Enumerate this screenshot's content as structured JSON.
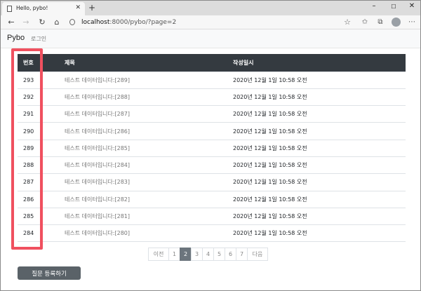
{
  "browser": {
    "tab_title": "Hello, pybo!",
    "url_host": "localhost",
    "url_rest": ":8000/pybo/?page=2",
    "new_tab": "+",
    "minimize": "–",
    "maximize": "☐",
    "close": "✕"
  },
  "navbar": {
    "brand": "Pybo",
    "login": "로그인"
  },
  "table": {
    "headers": {
      "num": "번호",
      "subject": "제목",
      "created": "작성일시"
    },
    "rows": [
      {
        "num": "293",
        "subject": "테스트 데이터입니다:[289]",
        "created": "2020년 12월 1일 10:58 오전"
      },
      {
        "num": "292",
        "subject": "테스트 데이터입니다:[288]",
        "created": "2020년 12월 1일 10:58 오전"
      },
      {
        "num": "291",
        "subject": "테스트 데이터입니다:[287]",
        "created": "2020년 12월 1일 10:58 오전"
      },
      {
        "num": "290",
        "subject": "테스트 데이터입니다:[286]",
        "created": "2020년 12월 1일 10:58 오전"
      },
      {
        "num": "289",
        "subject": "테스트 데이터입니다:[285]",
        "created": "2020년 12월 1일 10:58 오전"
      },
      {
        "num": "288",
        "subject": "테스트 데이터입니다:[284]",
        "created": "2020년 12월 1일 10:58 오전"
      },
      {
        "num": "287",
        "subject": "테스트 데이터입니다:[283]",
        "created": "2020년 12월 1일 10:58 오전"
      },
      {
        "num": "286",
        "subject": "테스트 데이터입니다:[282]",
        "created": "2020년 12월 1일 10:58 오전"
      },
      {
        "num": "285",
        "subject": "테스트 데이터입니다:[281]",
        "created": "2020년 12월 1일 10:58 오전"
      },
      {
        "num": "284",
        "subject": "테스트 데이터입니다:[280]",
        "created": "2020년 12월 1일 10:58 오전"
      }
    ]
  },
  "pagination": {
    "prev": "이전",
    "pages": [
      "1",
      "2",
      "3",
      "4",
      "5",
      "6",
      "7"
    ],
    "active_page": "2",
    "next": "다음"
  },
  "create_button": "질문 등록하기",
  "colors": {
    "highlight": "#f0505f",
    "table_header": "#343a40",
    "active_page": "#6c757d",
    "button": "#5a6268"
  }
}
